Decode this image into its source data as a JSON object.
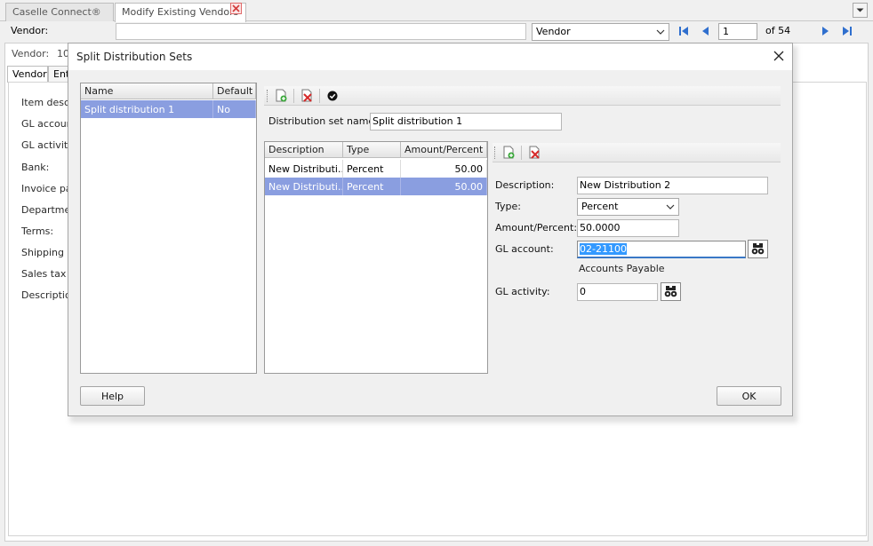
{
  "tabs": [
    {
      "label": "Caselle Connect®"
    },
    {
      "label": "Modify Existing Vendors"
    }
  ],
  "toolbar": {
    "vendor_label": "Vendor:",
    "search_value": "",
    "lookup_field": "Vendor",
    "page_current": "1",
    "page_total": "of 54"
  },
  "background": {
    "vendor_label": "Vendor:",
    "vendor_number": "10",
    "tabs": [
      "Vendor",
      "Enti"
    ],
    "fields": [
      "Item description:",
      "GL account:",
      "GL activity:",
      "Bank:",
      "Invoice payment:",
      "Department:",
      "Terms:",
      "Shipping address:",
      "Sales tax rate:",
      "Description:"
    ]
  },
  "dialog": {
    "title": "Split Distribution Sets",
    "sets_table": {
      "columns": [
        "Name",
        "Default"
      ],
      "rows": [
        {
          "name": "Split distribution 1",
          "default": "No"
        }
      ]
    },
    "set_name_label": "Distribution set name:",
    "set_name_value": "Split distribution 1",
    "dist_table": {
      "columns": [
        "Description",
        "Type",
        "Amount/Percent"
      ],
      "rows": [
        {
          "description": "New Distributi...",
          "type": "Percent",
          "amount": "50.00"
        },
        {
          "description": "New Distributi...",
          "type": "Percent",
          "amount": "50.00"
        }
      ]
    },
    "detail": {
      "description_label": "Description:",
      "description_value": "New Distribution 2",
      "type_label": "Type:",
      "type_value": "Percent",
      "amount_label": "Amount/Percent:",
      "amount_value": "50.0000",
      "gl_account_label": "GL account:",
      "gl_account_value": "02-21100",
      "gl_account_desc": "Accounts Payable",
      "gl_activity_label": "GL activity:",
      "gl_activity_value": "0"
    },
    "help_label": "Help",
    "ok_label": "OK"
  },
  "colors": {
    "selection": "#8a9ee0",
    "focus_underline": "#3a78c6",
    "text_highlight": "#3399ff"
  }
}
